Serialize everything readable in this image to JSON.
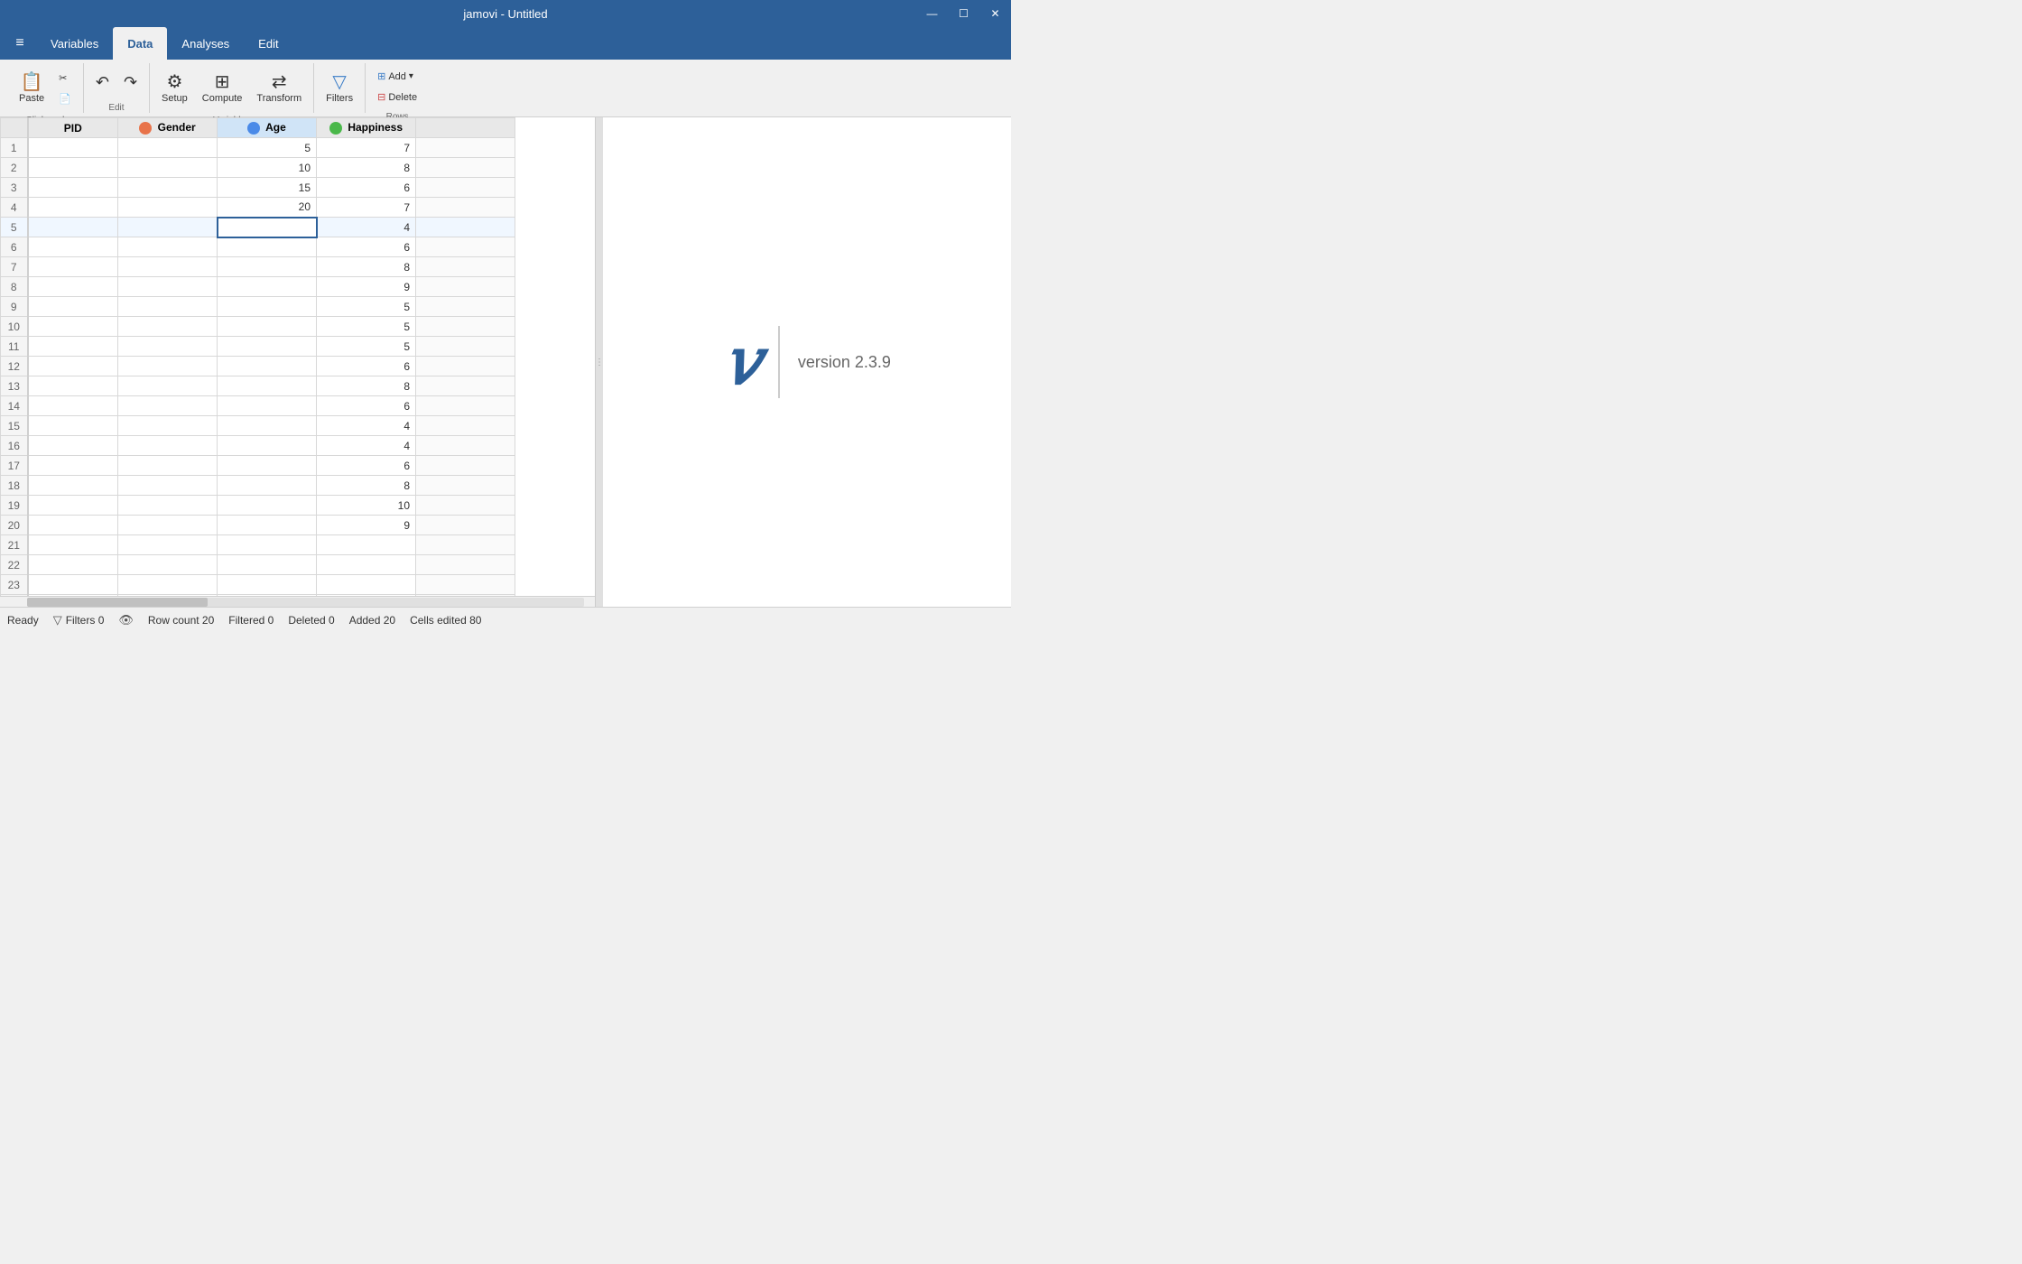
{
  "titleBar": {
    "title": "jamovi - Untitled",
    "minimizeLabel": "—",
    "maximizeLabel": "☐",
    "closeLabel": "✕"
  },
  "menuBar": {
    "hamburger": "≡",
    "tabs": [
      {
        "id": "variables",
        "label": "Variables",
        "active": false
      },
      {
        "id": "data",
        "label": "Data",
        "active": true
      },
      {
        "id": "analyses",
        "label": "Analyses",
        "active": false
      },
      {
        "id": "edit",
        "label": "Edit",
        "active": false
      }
    ]
  },
  "toolbar": {
    "clipboard": {
      "label": "Clipboard",
      "pasteLabel": "Paste",
      "cutLabel": "Cut",
      "copyLabel": "Copy"
    },
    "edit": {
      "label": "Edit",
      "undoLabel": "↶",
      "redoLabel": "↷"
    },
    "variables": {
      "label": "Variables",
      "setupLabel": "Setup",
      "computeLabel": "Compute",
      "transformLabel": "Transform"
    },
    "rows": {
      "label": "Rows",
      "addLabel": "Add",
      "deleteLabel": "Delete",
      "filtersLabel": "Filters"
    }
  },
  "columns": [
    {
      "id": "pid",
      "label": "PID",
      "type": "id",
      "icon": "none"
    },
    {
      "id": "gender",
      "label": "Gender",
      "type": "nominal",
      "icon": "nominal"
    },
    {
      "id": "age",
      "label": "Age",
      "type": "continuous",
      "icon": "continuous"
    },
    {
      "id": "happiness",
      "label": "Happiness",
      "type": "ordinal",
      "icon": "ordinal"
    }
  ],
  "data": {
    "age": [
      5,
      10,
      15,
      20,
      null,
      null,
      null,
      null,
      null,
      null,
      null,
      null,
      null,
      null,
      null,
      null,
      null,
      null,
      null,
      null
    ],
    "happiness": [
      7,
      8,
      6,
      7,
      4,
      6,
      8,
      9,
      5,
      5,
      5,
      6,
      8,
      6,
      4,
      4,
      6,
      8,
      10,
      9
    ]
  },
  "selectedCell": {
    "row": 5,
    "col": "age"
  },
  "resultsPanel": {
    "versionText": "version 2.3.9"
  },
  "statusBar": {
    "readyLabel": "Ready",
    "filterIcon": "▽",
    "eyeIcon": "👁",
    "filtersLabel": "Filters 0",
    "rowCountLabel": "Row count 20",
    "filteredLabel": "Filtered 0",
    "deletedLabel": "Deleted 0",
    "addedLabel": "Added 20",
    "cellsEditedLabel": "Cells edited 80"
  }
}
